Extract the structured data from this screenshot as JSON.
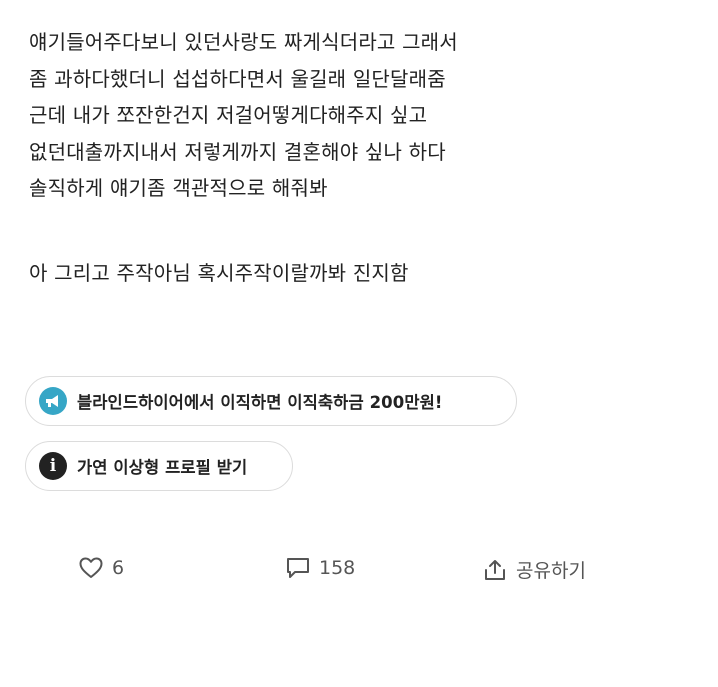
{
  "post": {
    "lines": [
      "얘기들어주다보니 있던사랑도 짜게식더라고 그래서",
      "좀 과하다했더니 섭섭하다면서 울길래 일단달래줌",
      "근데 내가 쪼잔한건지 저걸어떻게다해주지 싶고",
      "없던대출까지내서 저렇게까지 결혼해야 싶나 하다",
      "솔직하게 얘기좀 객관적으로 해줘봐",
      "아 그리고 주작아님 혹시주작이랄까봐 진지함"
    ]
  },
  "chips": {
    "ad": {
      "label": "블라인드하이어에서 이직하면 이직축하금 200만원!",
      "icon": "megaphone-icon",
      "icon_bg": "#36a6c6"
    },
    "info": {
      "label": "가연 이상형 프로필 받기",
      "icon": "info-icon",
      "icon_glyph": "i"
    }
  },
  "actions": {
    "likes": "6",
    "comments": "158",
    "share_label": "공유하기"
  }
}
